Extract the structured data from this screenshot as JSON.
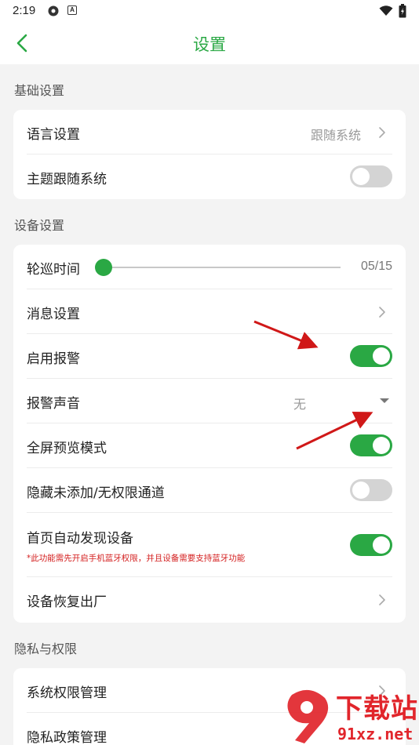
{
  "status_bar": {
    "time": "2:19"
  },
  "header": {
    "title": "设置",
    "back_icon": "chevron-left-icon"
  },
  "colors": {
    "accent": "#2aa844",
    "warning": "#d42020",
    "annotation_arrow": "#d01818"
  },
  "sections": {
    "basic": {
      "title": "基础设置",
      "language": {
        "label": "语言设置",
        "value": "跟随系统"
      },
      "theme": {
        "label": "主题跟随系统",
        "enabled": false
      }
    },
    "device": {
      "title": "设备设置",
      "patrol": {
        "label": "轮巡时间",
        "value": "05/15",
        "fraction": 0
      },
      "message": {
        "label": "消息设置"
      },
      "alarm": {
        "label": "启用报警",
        "enabled": true
      },
      "alarm_sound": {
        "label": "报警声音",
        "value": "无"
      },
      "fullscreen": {
        "label": "全屏预览模式",
        "enabled": true
      },
      "hide_channels": {
        "label": "隐藏未添加/无权限通道",
        "enabled": false
      },
      "auto_discover": {
        "label": "首页自动发现设备",
        "note": "*此功能需先开启手机蓝牙权限，并且设备需要支持蓝牙功能",
        "enabled": true
      },
      "factory_reset": {
        "label": "设备恢复出厂"
      }
    },
    "privacy": {
      "title": "隐私与权限",
      "permissions": {
        "label": "系统权限管理"
      },
      "policy": {
        "label": "隐私政策管理"
      }
    }
  },
  "watermark": {
    "main": "下载站",
    "sub": "91xz.net"
  }
}
